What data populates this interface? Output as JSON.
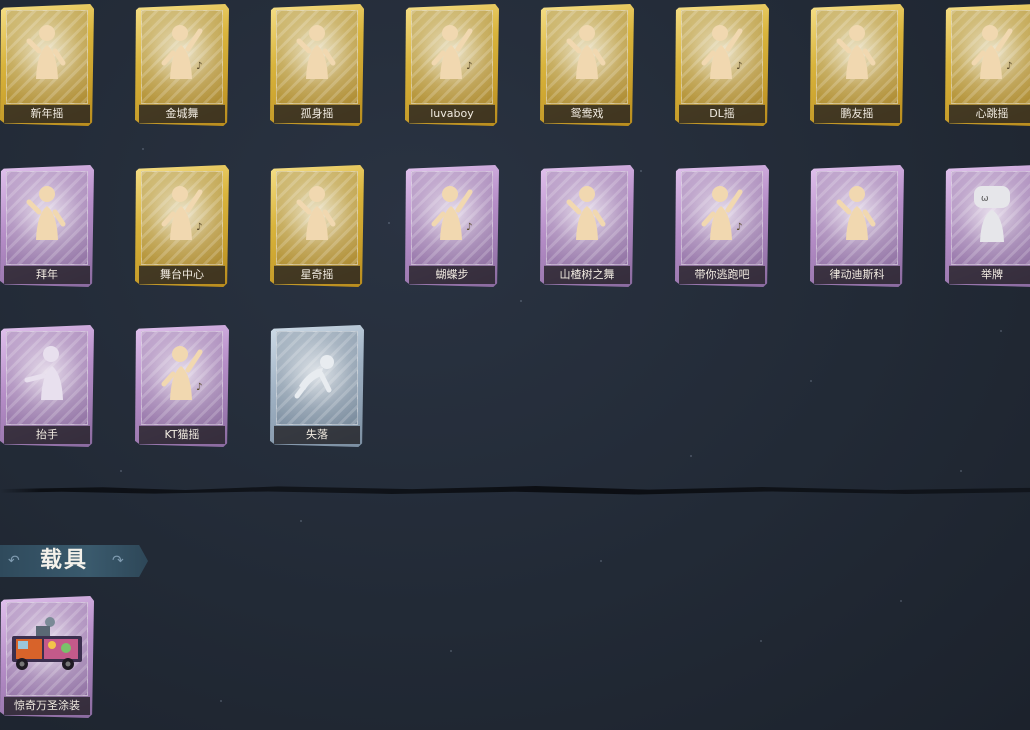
{
  "emotes": [
    {
      "label": "新年摇",
      "rarity": "gold",
      "icon": "figure-pose-icon"
    },
    {
      "label": "金城舞",
      "rarity": "gold",
      "icon": "figure-dance-icon"
    },
    {
      "label": "孤身摇",
      "rarity": "gold",
      "icon": "figure-pose-icon"
    },
    {
      "label": "luvaboy",
      "rarity": "gold",
      "icon": "figure-dance-icon"
    },
    {
      "label": "鸳鸯戏",
      "rarity": "gold",
      "icon": "figure-pose-icon"
    },
    {
      "label": "DL摇",
      "rarity": "gold",
      "icon": "figure-dance-icon"
    },
    {
      "label": "鹏友摇",
      "rarity": "gold",
      "icon": "figure-pose-icon"
    },
    {
      "label": "心跳摇",
      "rarity": "gold",
      "icon": "figure-dance-icon"
    },
    {
      "label": "拜年",
      "rarity": "purple",
      "icon": "figure-pose-icon"
    },
    {
      "label": "舞台中心",
      "rarity": "gold",
      "icon": "figure-dance-icon"
    },
    {
      "label": "星奇摇",
      "rarity": "gold",
      "icon": "figure-pose-icon"
    },
    {
      "label": "蝴蝶步",
      "rarity": "purple",
      "icon": "figure-dance-icon"
    },
    {
      "label": "山楂树之舞",
      "rarity": "purple",
      "icon": "figure-pose-icon"
    },
    {
      "label": "带你逃跑吧",
      "rarity": "purple",
      "icon": "figure-dance-icon"
    },
    {
      "label": "律动迪斯科",
      "rarity": "purple",
      "icon": "figure-pose-icon"
    },
    {
      "label": "举牌",
      "rarity": "purple",
      "icon": "figure-sign-icon"
    },
    {
      "label": "抬手",
      "rarity": "purple",
      "icon": "figure-wave-icon"
    },
    {
      "label": "KT猫摇",
      "rarity": "purple",
      "icon": "figure-dance-icon"
    },
    {
      "label": "失落",
      "rarity": "blue",
      "icon": "figure-crawl-icon"
    }
  ],
  "vehicle_section": {
    "title": "载具",
    "items": [
      {
        "label": "惊奇万圣涂装",
        "rarity": "purple",
        "icon": "truck-icon"
      }
    ]
  },
  "colors": {
    "gold": "#d9b43c",
    "purple": "#b68ec8",
    "blue": "#9fb1c3",
    "background": "#222a36",
    "section_header": "#3a5a6d"
  }
}
